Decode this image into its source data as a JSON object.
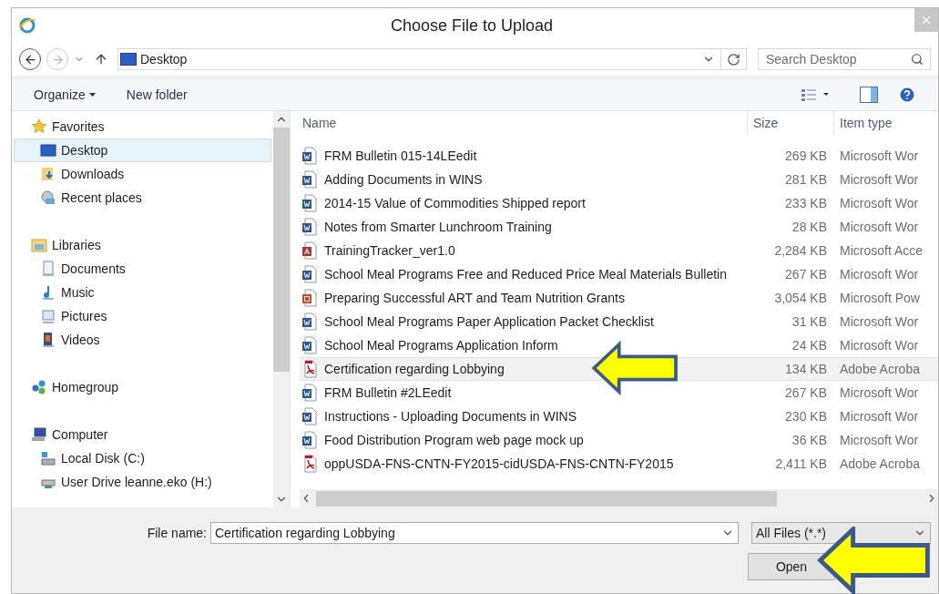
{
  "window": {
    "title": "Choose File to Upload"
  },
  "address_bar": {
    "location": "Desktop"
  },
  "search": {
    "placeholder": "Search Desktop"
  },
  "toolbar": {
    "organize": "Organize",
    "new_folder": "New folder"
  },
  "navigation": [
    {
      "label": "Favorites",
      "kind": "favorites",
      "selected": false,
      "children": [
        {
          "label": "Desktop",
          "kind": "desktop",
          "selected": true
        },
        {
          "label": "Downloads",
          "kind": "downloads",
          "selected": false
        },
        {
          "label": "Recent places",
          "kind": "recent",
          "selected": false
        }
      ]
    },
    {
      "label": "Libraries",
      "kind": "libraries",
      "selected": false,
      "children": [
        {
          "label": "Documents",
          "kind": "documents",
          "selected": false
        },
        {
          "label": "Music",
          "kind": "music",
          "selected": false
        },
        {
          "label": "Pictures",
          "kind": "pictures",
          "selected": false
        },
        {
          "label": "Videos",
          "kind": "videos",
          "selected": false
        }
      ]
    },
    {
      "label": "Homegroup",
      "kind": "homegroup",
      "selected": false
    },
    {
      "label": "Computer",
      "kind": "computer",
      "selected": false,
      "children": [
        {
          "label": "Local Disk (C:)",
          "kind": "disk",
          "selected": false
        },
        {
          "label": "User Drive leanne.eko (H:)",
          "kind": "drive",
          "selected": false
        }
      ]
    }
  ],
  "file_list": {
    "columns": [
      "Name",
      "Size",
      "Item type"
    ],
    "rows": [
      {
        "name": "FRM Bulletin 015-14LEedit",
        "size": "269 KB",
        "type": "Microsoft Wor",
        "kind": "word",
        "selected": false
      },
      {
        "name": "Adding Documents in WINS",
        "size": "281 KB",
        "type": "Microsoft Wor",
        "kind": "word",
        "selected": false
      },
      {
        "name": "2014-15 Value of Commodities Shipped report",
        "size": "233 KB",
        "type": "Microsoft Wor",
        "kind": "word",
        "selected": false
      },
      {
        "name": "Notes from Smarter Lunchroom Training",
        "size": "28 KB",
        "type": "Microsoft Wor",
        "kind": "word",
        "selected": false
      },
      {
        "name": "TrainingTracker_ver1.0",
        "size": "2,284 KB",
        "type": "Microsoft Acce",
        "kind": "access",
        "selected": false
      },
      {
        "name": "School Meal Programs Free and Reduced Price Meal Materials Bulletin",
        "size": "267 KB",
        "type": "Microsoft Wor",
        "kind": "word",
        "selected": false
      },
      {
        "name": "Preparing Successful ART and Team Nutrition Grants",
        "size": "3,054 KB",
        "type": "Microsoft Pow",
        "kind": "powerpoint",
        "selected": false
      },
      {
        "name": "School Meal Programs Paper Application Packet Checklist",
        "size": "31 KB",
        "type": "Microsoft Wor",
        "kind": "word",
        "selected": false
      },
      {
        "name": "School Meal Programs Application Inform",
        "size": "24 KB",
        "type": "Microsoft Wor",
        "kind": "word",
        "selected": false
      },
      {
        "name": "Certification regarding Lobbying",
        "size": "134 KB",
        "type": "Adobe Acroba",
        "kind": "pdf",
        "selected": true
      },
      {
        "name": "FRM Bulletin #2LEedit",
        "size": "267 KB",
        "type": "Microsoft Wor",
        "kind": "word",
        "selected": false
      },
      {
        "name": "Instructions - Uploading Documents in WINS",
        "size": "230 KB",
        "type": "Microsoft Wor",
        "kind": "word",
        "selected": false
      },
      {
        "name": "Food Distribution Program web page mock up",
        "size": "36 KB",
        "type": "Microsoft Wor",
        "kind": "word",
        "selected": false
      },
      {
        "name": "oppUSDA-FNS-CNTN-FY2015-cidUSDA-FNS-CNTN-FY2015",
        "size": "2,411 KB",
        "type": "Adobe Acroba",
        "kind": "pdf",
        "selected": false
      }
    ]
  },
  "footer": {
    "file_name_label": "File name:",
    "file_name": "Certification regarding Lobbying",
    "file_type": "All Files (*.*)",
    "open_button": "Open"
  }
}
